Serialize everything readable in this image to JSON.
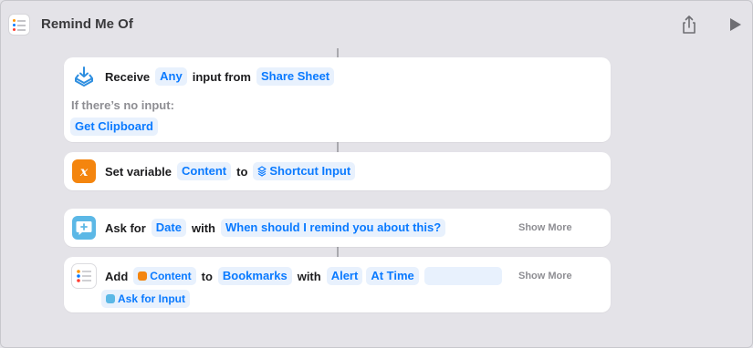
{
  "window": {
    "title": "Remind Me Of",
    "share_icon": "share-icon",
    "run_icon": "play-icon"
  },
  "actions": {
    "receive": {
      "icon": "receive-tray-icon",
      "word_receive": "Receive",
      "type_token": "Any",
      "word_input_from": "input from",
      "source_token": "Share Sheet",
      "no_input_label": "If there’s no input:",
      "fallback_token": "Get Clipboard"
    },
    "set_variable": {
      "icon": "variable-x-icon",
      "word_set": "Set variable",
      "variable_token": "Content",
      "word_to": "to",
      "value_token": "Shortcut Input"
    },
    "ask_for": {
      "icon": "speech-bubble-plus-icon",
      "word_ask": "Ask for",
      "type_token": "Date",
      "word_with": "with",
      "prompt_token": "When should I remind you about this?",
      "show_more": "Show More"
    },
    "add": {
      "icon": "reminders-list-icon",
      "word_add": "Add",
      "content_token": "Content",
      "word_to": "to",
      "list_token": "Bookmarks",
      "word_with": "with",
      "alert_token": "Alert",
      "time_token": "At Time",
      "show_more": "Show More",
      "ask_token": "Ask for Input"
    }
  },
  "colors": {
    "accent": "#0a7aff",
    "token_bg": "#e8f1fd",
    "receive_icon": "#2f8fe0",
    "variable_icon": "#f4850e",
    "ask_icon": "#5cb8e6",
    "background": "#e4e3e8"
  }
}
